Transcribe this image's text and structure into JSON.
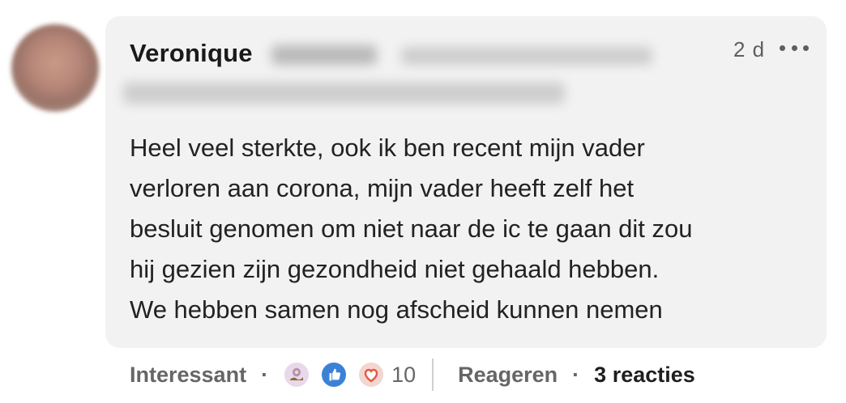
{
  "comment": {
    "author_first_name": "Veronique",
    "timestamp": "2 d",
    "text_lines": [
      "Heel veel sterkte, ook ik ben recent mijn vader",
      "verloren aan corona, mijn vader heeft zelf het",
      "besluit genomen om niet naar de ic te gaan dit zou",
      "hij gezien zijn gezondheid niet gehaald hebben.",
      "We hebben samen nog afscheid kunnen nemen"
    ]
  },
  "actions": {
    "reaction_label": "Interessant",
    "separator": "·",
    "reaction_icons": [
      "insightful-icon",
      "like-icon",
      "love-icon"
    ],
    "reaction_count": "10",
    "reply_label": "Reageren",
    "replies_count_label": "3 reacties"
  },
  "colors": {
    "bubble_bg": "#f2f2f2",
    "muted_text": "#666666",
    "like_blue": "#3b82d6",
    "love_red": "#e8573f"
  }
}
